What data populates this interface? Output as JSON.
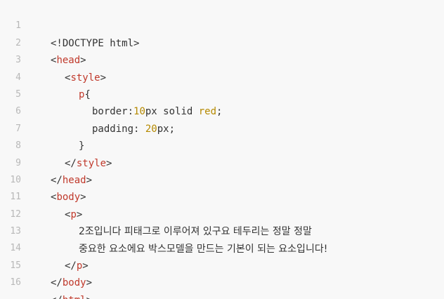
{
  "editor": {
    "line_numbers": [
      "1",
      "2",
      "3",
      "4",
      "5",
      "6",
      "7",
      "8",
      "9",
      "10",
      "11",
      "12",
      "13",
      "14",
      "15",
      "16"
    ],
    "lines": {
      "l1": "<!DOCTYPE html>",
      "l2_open": "<",
      "l2_tag": "head",
      "l2_close": ">",
      "l3_open": "<",
      "l3_tag": "style",
      "l3_close": ">",
      "l4_sel": "p",
      "l4_brace": "{",
      "l5_prop": "border:",
      "l5_num": "10",
      "l5_unit": "px solid ",
      "l5_kw": "red",
      "l5_semi": ";",
      "l6_prop": "padding: ",
      "l6_num": "20",
      "l6_unit": "px",
      "l6_semi": ";",
      "l7": "}",
      "l8_open": "</",
      "l8_tag": "style",
      "l8_close": ">",
      "l9_open": "</",
      "l9_tag": "head",
      "l9_close": ">",
      "l10_open": "<",
      "l10_tag": "body",
      "l10_close": ">",
      "l11_open": "<",
      "l11_tag": "p",
      "l11_close": ">",
      "l12": "2조입니다 피태그로 이루어져 있구요 테두리는 정말 정말",
      "l13": "중요한 요소에요 박스모델을 만드는 기본이 되는 요소입니다!",
      "l14_open": "</",
      "l14_tag": "p",
      "l14_close": ">",
      "l15_open": "</",
      "l15_tag": "body",
      "l15_close": ">",
      "l16_open": "</",
      "l16_tag": "html",
      "l16_close": ">"
    }
  },
  "colors": {
    "background": "#f8f8f8",
    "tag": "#c0392b",
    "number": "#b58900",
    "line_number": "#b8b8b8",
    "text": "#333333"
  }
}
